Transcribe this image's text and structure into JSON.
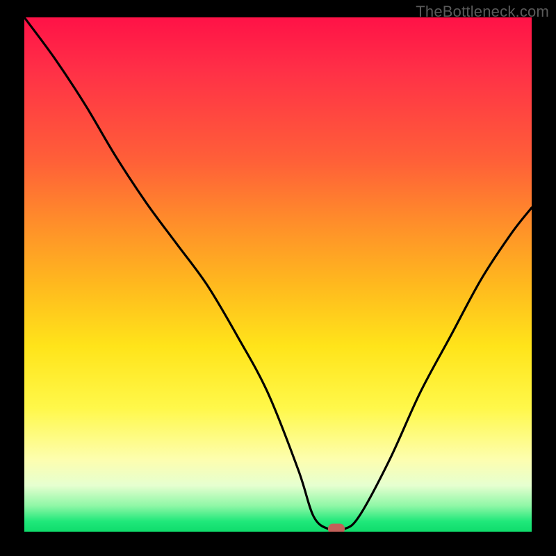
{
  "watermark": "TheBottleneck.com",
  "chart_data": {
    "type": "line",
    "title": "",
    "xlabel": "",
    "ylabel": "",
    "xlim": [
      0,
      100
    ],
    "ylim": [
      0,
      100
    ],
    "legend": false,
    "grid": false,
    "background_gradient": {
      "direction": "vertical",
      "stops": [
        {
          "pos": 0,
          "color": "#ff1247"
        },
        {
          "pos": 28,
          "color": "#ff6038"
        },
        {
          "pos": 52,
          "color": "#ffb91e"
        },
        {
          "pos": 76,
          "color": "#fff84a"
        },
        {
          "pos": 91,
          "color": "#e6ffd0"
        },
        {
          "pos": 100,
          "color": "#0fdc6c"
        }
      ]
    },
    "series": [
      {
        "name": "bottleneck-curve",
        "x": [
          0,
          6,
          12,
          18,
          24,
          30,
          36,
          42,
          48,
          54,
          57,
          60,
          63,
          66,
          72,
          78,
          84,
          90,
          96,
          100
        ],
        "y": [
          100,
          92,
          83,
          73,
          64,
          56,
          48,
          38,
          27,
          12,
          3,
          0.5,
          0.5,
          3,
          14,
          27,
          38,
          49,
          58,
          63
        ]
      }
    ],
    "marker": {
      "name": "optimal-point",
      "x": 61.5,
      "y": 0.5,
      "color": "#c26059",
      "shape": "rounded-rect"
    }
  }
}
